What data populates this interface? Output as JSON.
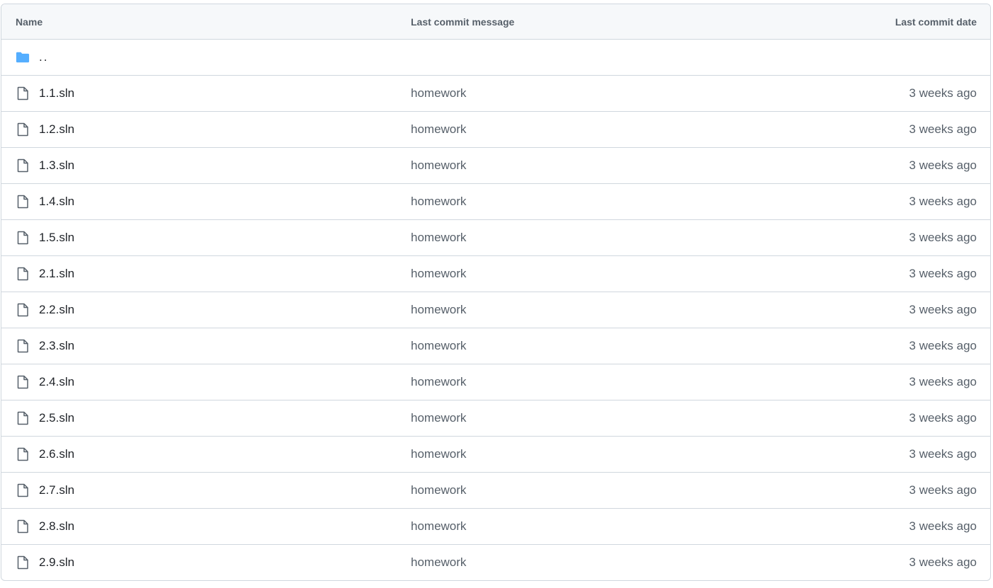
{
  "table": {
    "headers": {
      "name": "Name",
      "message": "Last commit message",
      "date": "Last commit date"
    },
    "parent": {
      "label": "..",
      "icon": "folder-icon",
      "color": "#54aeff"
    },
    "rows": [
      {
        "name": "1.1.sln",
        "message": "homework",
        "date": "3 weeks ago"
      },
      {
        "name": "1.2.sln",
        "message": "homework",
        "date": "3 weeks ago"
      },
      {
        "name": "1.3.sln",
        "message": "homework",
        "date": "3 weeks ago"
      },
      {
        "name": "1.4.sln",
        "message": "homework",
        "date": "3 weeks ago"
      },
      {
        "name": "1.5.sln",
        "message": "homework",
        "date": "3 weeks ago"
      },
      {
        "name": "2.1.sln",
        "message": "homework",
        "date": "3 weeks ago"
      },
      {
        "name": "2.2.sln",
        "message": "homework",
        "date": "3 weeks ago"
      },
      {
        "name": "2.3.sln",
        "message": "homework",
        "date": "3 weeks ago"
      },
      {
        "name": "2.4.sln",
        "message": "homework",
        "date": "3 weeks ago"
      },
      {
        "name": "2.5.sln",
        "message": "homework",
        "date": "3 weeks ago"
      },
      {
        "name": "2.6.sln",
        "message": "homework",
        "date": "3 weeks ago"
      },
      {
        "name": "2.7.sln",
        "message": "homework",
        "date": "3 weeks ago"
      },
      {
        "name": "2.8.sln",
        "message": "homework",
        "date": "3 weeks ago"
      },
      {
        "name": "2.9.sln",
        "message": "homework",
        "date": "3 weeks ago"
      }
    ]
  }
}
